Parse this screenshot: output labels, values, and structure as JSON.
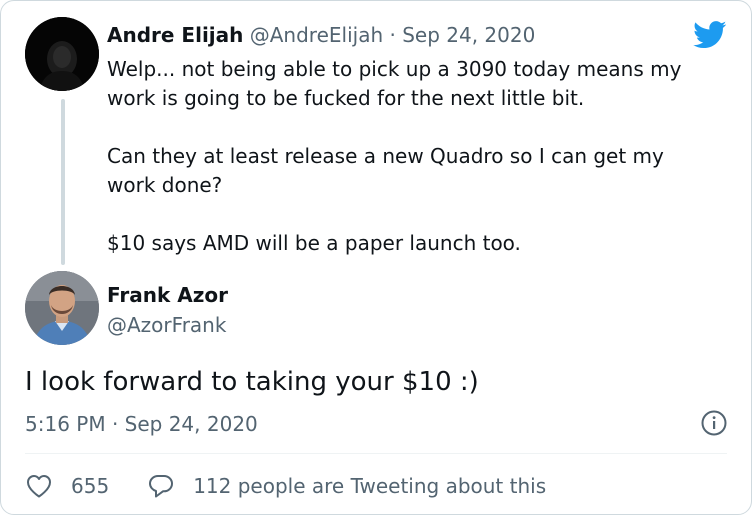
{
  "reply_tweet": {
    "display_name": "Andre Elijah",
    "handle": "@AndreElijah",
    "separator": "·",
    "date": "Sep 24, 2020",
    "paragraphs": [
      "Welp... not being able to pick up a 3090 today means my work is going to be fucked for the next little bit.",
      "Can they at least release a new Quadro so I can get my work done?",
      "$10 says AMD will be a paper launch too."
    ]
  },
  "main_tweet": {
    "display_name": "Frank Azor",
    "handle": "@AzorFrank",
    "text": "I look forward to taking your $10 :)",
    "timestamp": "5:16 PM · Sep 24, 2020"
  },
  "actions": {
    "like_count": "655",
    "conversation_label": "112 people are Tweeting about this"
  },
  "icons": {
    "logo": "twitter-bird-icon",
    "info": "info-icon",
    "like": "heart-icon",
    "reply": "speech-bubble-icon"
  },
  "colors": {
    "brand": "#1d9bf0",
    "text": "#0f1419",
    "secondary": "#536471",
    "border": "#cfd9de"
  }
}
